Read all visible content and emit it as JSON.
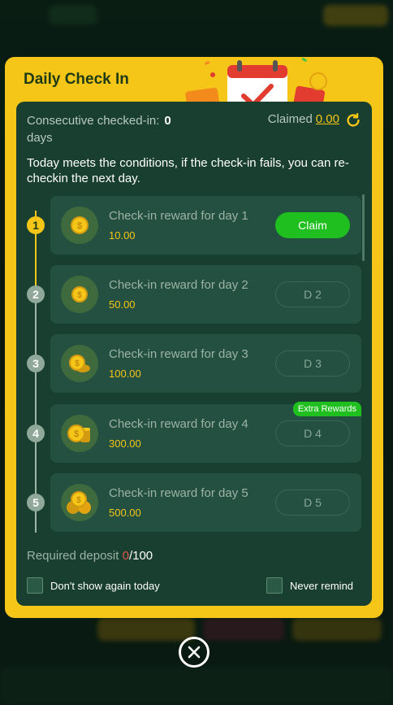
{
  "modal": {
    "title": "Daily Check In",
    "consecutive_label": "Consecutive checked-in:",
    "consecutive_value": "0",
    "consecutive_unit": "days",
    "claimed_label": "Claimed",
    "claimed_value": "0.00",
    "notice": "Today meets the conditions, if the check-in fails, you can re-checkin the next day."
  },
  "rewards": [
    {
      "step": "1",
      "title": "Check-in reward for day 1",
      "amount": "10.00",
      "action": "Claim"
    },
    {
      "step": "2",
      "title": "Check-in reward for day 2",
      "amount": "50.00",
      "action": "D 2"
    },
    {
      "step": "3",
      "title": "Check-in reward for day 3",
      "amount": "100.00",
      "action": "D 3"
    },
    {
      "step": "4",
      "title": "Check-in reward for day 4",
      "amount": "300.00",
      "action": "D 4",
      "badge": "Extra Rewards"
    },
    {
      "step": "5",
      "title": "Check-in reward for day 5",
      "amount": "500.00",
      "action": "D 5"
    }
  ],
  "deposit": {
    "label": "Required deposit",
    "current": "0",
    "total": "/100"
  },
  "options": {
    "dont_show_today": "Don't show again today",
    "never_remind": "Never remind"
  },
  "icons": {
    "refresh": "refresh-icon",
    "close": "close-icon",
    "coin": "coin-icon"
  },
  "colors": {
    "accent": "#f5c518",
    "claim": "#1fbf1f",
    "panel": "#183f2f"
  }
}
